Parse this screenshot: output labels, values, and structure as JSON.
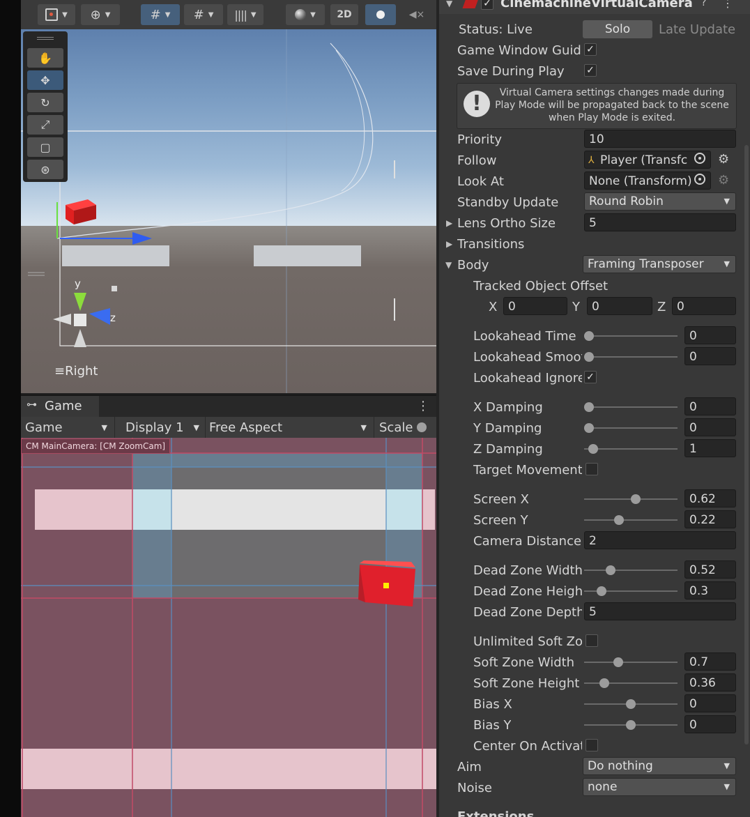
{
  "scene": {
    "toolbar": {
      "two_d_label": "2D"
    },
    "orientation_label": "Right",
    "gizmo_y": "y",
    "gizmo_z": "z"
  },
  "game": {
    "tab_label": "Game",
    "selector_game": "Game",
    "selector_display": "Display 1",
    "selector_aspect": "Free Aspect",
    "scale_label": "Scale",
    "camera_label": "CM MainCamera: [CM ZoomCam]"
  },
  "inspector": {
    "component_title": "CinemachineVirtualCamera",
    "status_label": "Status: Live",
    "solo_label": "Solo",
    "late_update_label": "Late Update",
    "game_window_guides_label": "Game Window Guide",
    "save_during_play_label": "Save During Play",
    "help_message": "Virtual Camera settings changes made during Play Mode will be propagated back to the scene when Play Mode is exited.",
    "priority_label": "Priority",
    "priority_value": "10",
    "follow_label": "Follow",
    "follow_value": "Player (Transfc",
    "look_at_label": "Look At",
    "look_at_value": "None (Transform)",
    "standby_label": "Standby Update",
    "standby_value": "Round Robin",
    "lens_label": "Lens Ortho Size",
    "lens_value": "5",
    "transitions_label": "Transitions",
    "body_label": "Body",
    "body_value": "Framing Transposer",
    "tracked_offset_label": "Tracked Object Offset",
    "x_label": "X",
    "x_value": "0",
    "y_label": "Y",
    "y_value": "0",
    "z_label": "Z",
    "z_value": "0",
    "lookahead_time_label": "Lookahead Time",
    "lookahead_time_value": "0",
    "lookahead_smooth_label": "Lookahead Smoot",
    "lookahead_smooth_value": "0",
    "lookahead_ignore_label": "Lookahead Ignore",
    "x_damping_label": "X Damping",
    "x_damping_value": "0",
    "y_damping_label": "Y Damping",
    "y_damping_value": "0",
    "z_damping_label": "Z Damping",
    "z_damping_value": "1",
    "target_movement_label": "Target Movement",
    "screen_x_label": "Screen X",
    "screen_x_value": "0.62",
    "screen_y_label": "Screen Y",
    "screen_y_value": "0.22",
    "camera_distance_label": "Camera Distance",
    "camera_distance_value": "2",
    "dead_zone_width_label": "Dead Zone Width",
    "dead_zone_width_value": "0.52",
    "dead_zone_height_label": "Dead Zone Heigh",
    "dead_zone_height_value": "0.3",
    "dead_zone_depth_label": "Dead Zone Depth",
    "dead_zone_depth_value": "5",
    "unlimited_soft_label": "Unlimited Soft Zor",
    "soft_zone_width_label": "Soft Zone Width",
    "soft_zone_width_value": "0.7",
    "soft_zone_height_label": "Soft Zone Height",
    "soft_zone_height_value": "0.36",
    "bias_x_label": "Bias X",
    "bias_x_value": "0",
    "bias_y_label": "Bias Y",
    "bias_y_value": "0",
    "center_on_activate_label": "Center On Activat",
    "aim_label": "Aim",
    "aim_value": "Do nothing",
    "noise_label": "Noise",
    "noise_value": "none",
    "extensions_label": "Extensions"
  },
  "colors": {
    "accent": "#46607c",
    "inspector_bg": "#383838",
    "game_overlay": "#7a5260",
    "cube": "#e0202c"
  }
}
